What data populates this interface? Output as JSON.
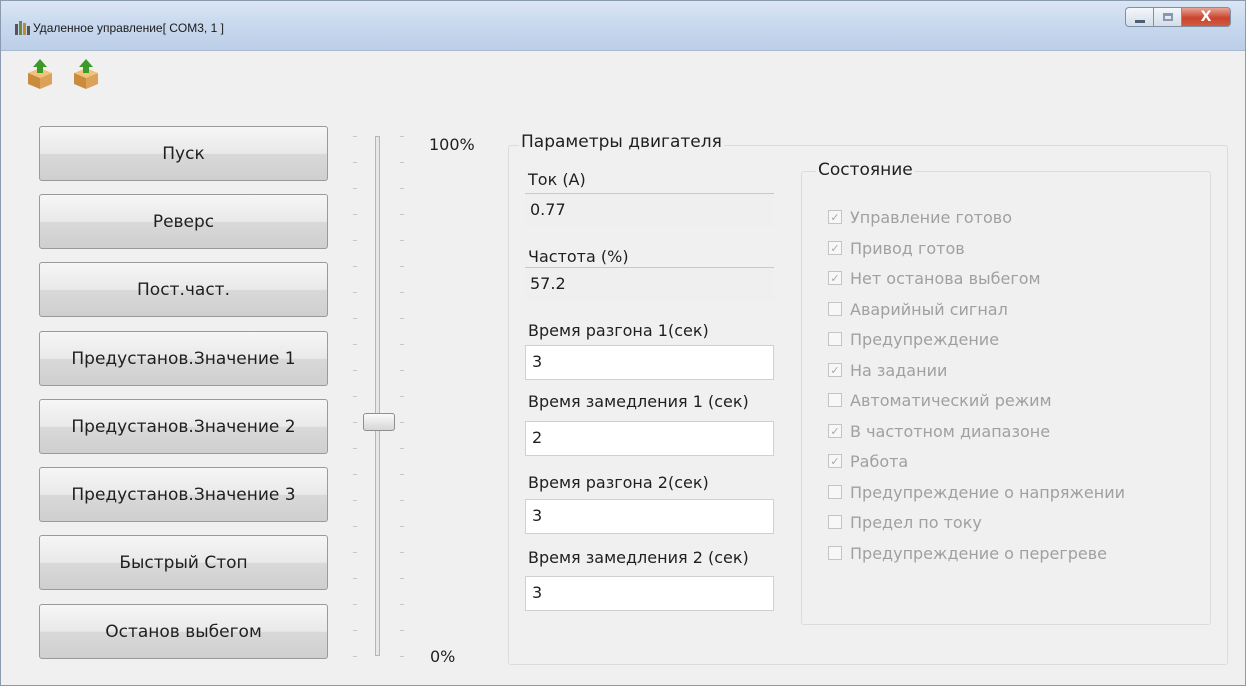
{
  "window": {
    "title": "Удаленное управление[ COM3, 1 ]",
    "close_glyph": "X"
  },
  "toolbar": {
    "icons": [
      "upload-box-icon",
      "download-box-icon"
    ]
  },
  "buttons": {
    "start": "Пуск",
    "reverse": "Реверс",
    "const_freq": "Пост.част.",
    "preset1": "Предустанов.Значение 1",
    "preset2": "Предустанов.Значение 2",
    "preset3": "Предустанов.Значение 3",
    "quick_stop": "Быстрый Стоп",
    "coast_stop": "Останов выбегом"
  },
  "slider": {
    "max_label": "100%",
    "min_label": "0%",
    "value_percent": 45
  },
  "motor_params": {
    "title": "Параметры двигателя",
    "current_label": "Ток (A)",
    "current_value": "0.77",
    "freq_label": "Частота (%)",
    "freq_value": "57.2",
    "accel1_label": "Время разгона 1(сек)",
    "accel1_value": "3",
    "decel1_label": "Время замедления 1 (сек)",
    "decel1_value": "2",
    "accel2_label": "Время разгона 2(сек)",
    "accel2_value": "3",
    "decel2_label": "Время замедления 2 (сек)",
    "decel2_value": "3"
  },
  "status": {
    "title": "Состояние",
    "items": [
      {
        "label": "Управление готово",
        "checked": true
      },
      {
        "label": "Привод готов",
        "checked": true
      },
      {
        "label": "Нет останова выбегом",
        "checked": true
      },
      {
        "label": "Аварийный сигнал",
        "checked": false
      },
      {
        "label": "Предупреждение",
        "checked": false
      },
      {
        "label": "На задании",
        "checked": true
      },
      {
        "label": "Автоматический режим",
        "checked": false
      },
      {
        "label": "В частотном диапазоне",
        "checked": true
      },
      {
        "label": "Работа",
        "checked": true
      },
      {
        "label": "Предупреждение о напряжении",
        "checked": false
      },
      {
        "label": "Предел по току",
        "checked": false
      },
      {
        "label": "Предупреждение о перегреве",
        "checked": false
      }
    ]
  }
}
